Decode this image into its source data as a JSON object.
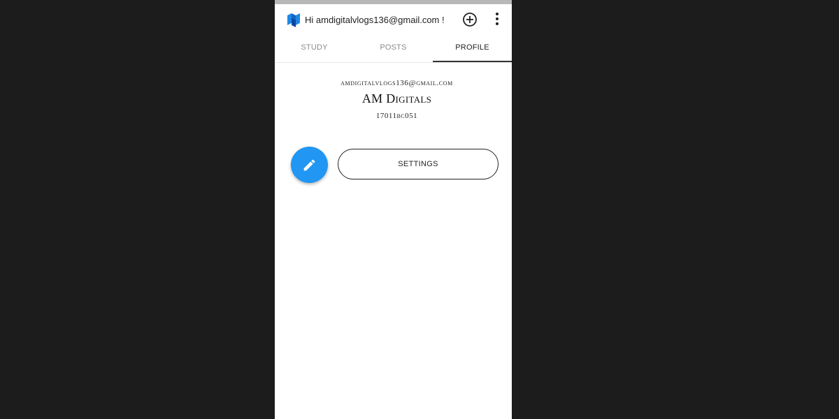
{
  "header": {
    "greeting": "Hi amdigitalvlogs136@gmail.com !",
    "logo_icon": "app-logo-icon",
    "add_icon": "plus-circle-icon",
    "more_icon": "more-vertical-icon"
  },
  "tabs": [
    {
      "label": "STUDY",
      "active": false
    },
    {
      "label": "POSTS",
      "active": false
    },
    {
      "label": "PROFILE",
      "active": true
    }
  ],
  "profile": {
    "email": "amdigitalvlogs136@gmail.com",
    "name": "AM Digitals",
    "id": "17011BC051"
  },
  "actions": {
    "edit_icon": "pencil-icon",
    "settings_label": "SETTINGS"
  },
  "colors": {
    "accent": "#2196f3",
    "logo_blue": "#1565c0"
  }
}
